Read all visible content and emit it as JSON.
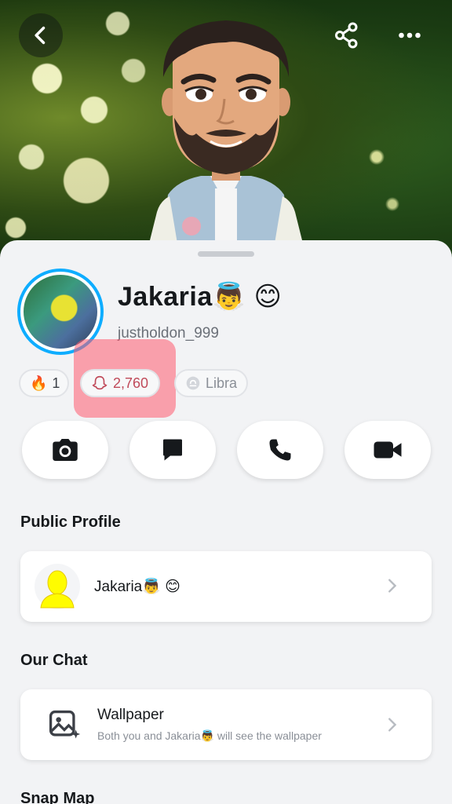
{
  "profile": {
    "display_name": "Jakaria👼 😊",
    "username": "justholdon_999"
  },
  "chips": {
    "streak_count": "1",
    "snap_score": "2,760",
    "zodiac": "Libra"
  },
  "actions": [
    "camera-icon",
    "chat-icon",
    "phone-icon",
    "video-icon"
  ],
  "public_profile": {
    "section_title": "Public Profile",
    "name": "Jakaria👼 😊"
  },
  "our_chat": {
    "section_title": "Our Chat",
    "title": "Wallpaper",
    "subtitle": "Both you and Jakaria👼 will see the wallpaper"
  },
  "snap_map": {
    "section_title": "Snap Map"
  },
  "colors": {
    "accent_ring": "#0eadff",
    "highlight": "#ff5a6e",
    "background": "#f2f3f5"
  }
}
